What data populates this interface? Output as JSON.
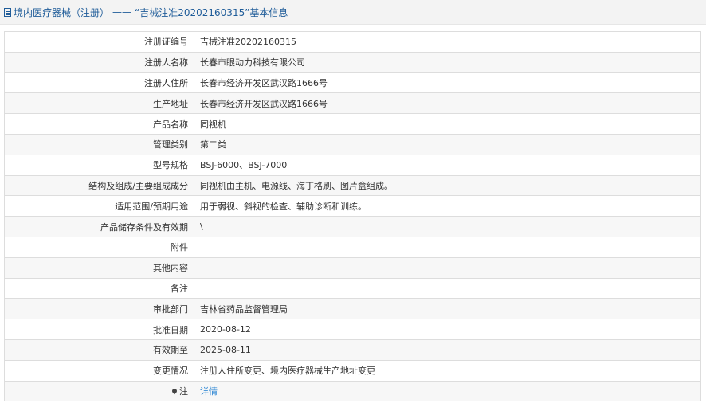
{
  "header": {
    "section": "境内医疗器械（注册）",
    "separator": "——",
    "record_title": "“吉械注准20202160315”基本信息"
  },
  "rows": [
    {
      "label": "注册证编号",
      "value": "吉械注准20202160315"
    },
    {
      "label": "注册人名称",
      "value": "长春市眼动力科技有限公司"
    },
    {
      "label": "注册人住所",
      "value": "长春市经济开发区武汉路1666号"
    },
    {
      "label": "生产地址",
      "value": "长春市经济开发区武汉路1666号"
    },
    {
      "label": "产品名称",
      "value": "同视机"
    },
    {
      "label": "管理类别",
      "value": "第二类"
    },
    {
      "label": "型号规格",
      "value": "BSJ-6000、BSJ-7000"
    },
    {
      "label": "结构及组成/主要组成成分",
      "value": "同视机由主机、电源线、海丁格刷、图片盒组成。"
    },
    {
      "label": "适用范围/预期用途",
      "value": "用于弱视、斜视的检查、辅助诊断和训练。"
    },
    {
      "label": "产品储存条件及有效期",
      "value": "\\"
    },
    {
      "label": "附件",
      "value": ""
    },
    {
      "label": "其他内容",
      "value": ""
    },
    {
      "label": "备注",
      "value": ""
    },
    {
      "label": "审批部门",
      "value": "吉林省药品监督管理局"
    },
    {
      "label": "批准日期",
      "value": "2020-08-12"
    },
    {
      "label": "有效期至",
      "value": "2025-08-11"
    },
    {
      "label": "变更情况",
      "value": "注册人住所变更、境内医疗器械生产地址变更"
    }
  ],
  "note": {
    "label": "注",
    "link": "详情",
    "icon": "pin-icon"
  }
}
